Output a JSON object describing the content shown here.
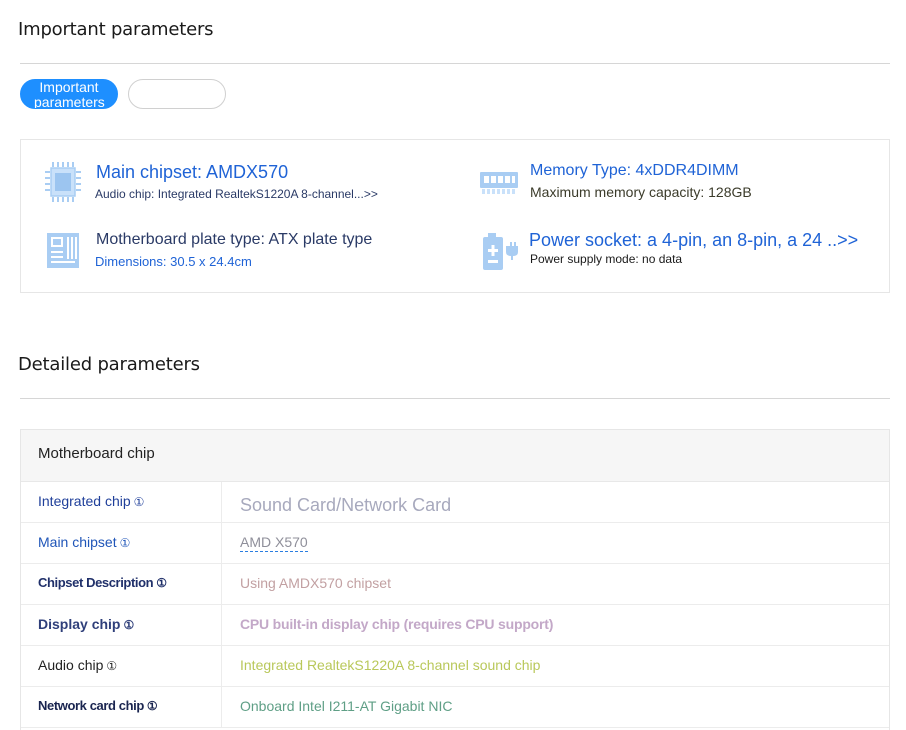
{
  "top": {
    "title": "Important parameters",
    "tabs": [
      {
        "label": "Important parameters",
        "active": true
      },
      {
        "label": "",
        "active": false
      }
    ]
  },
  "summary": {
    "chipset": {
      "icon": "chip-icon",
      "main": "Main chipset: AMDX570",
      "sub": "Audio chip: Integrated RealtekS1220A 8-channel...>>"
    },
    "memory": {
      "icon": "memory-icon",
      "main": "Memory Type: 4xDDR4DIMM",
      "sub": "Maximum memory capacity: 128GB"
    },
    "board": {
      "icon": "motherboard-icon",
      "main": "Motherboard plate type: ATX plate type",
      "sub": "Dimensions: 30.5 x 24.4cm"
    },
    "power": {
      "icon": "power-socket-icon",
      "main": "Power socket: a 4-pin, an 8-pin, a 24 ..>>",
      "sub": "Power supply mode: no data"
    }
  },
  "detail": {
    "title": "Detailed parameters",
    "group": "Motherboard chip",
    "info_glyph": "①",
    "rows": [
      {
        "key": "Integrated chip",
        "value": "Sound Card/Network Card"
      },
      {
        "key": "Main chipset",
        "value": "AMD X570"
      },
      {
        "key": "Chipset Description",
        "value": "Using AMDX570 chipset"
      },
      {
        "key": "Display chip",
        "value": "CPU built-in display chip (requires CPU support)"
      },
      {
        "key": "Audio chip",
        "value": "Integrated RealtekS1220A 8-channel sound chip"
      },
      {
        "key": "Network card chip",
        "value": "Onboard Intel I211-AT Gigabit NIC"
      }
    ]
  },
  "colors": {
    "accent": "#1e8fff",
    "link": "#1f63d6",
    "icon": "#9fc4f0"
  }
}
